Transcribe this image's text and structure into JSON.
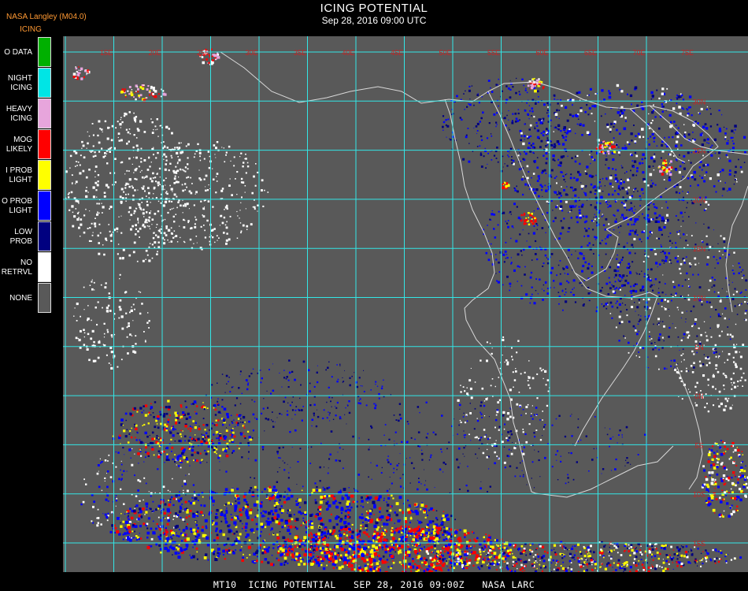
{
  "header": {
    "title": "ICING POTENTIAL",
    "subtitle": "Sep 28, 2016 09:00 UTC",
    "source": "NASA Langley (M04.0)",
    "product": "ICING"
  },
  "legend": [
    {
      "label": "O DATA",
      "color": "#00b000"
    },
    {
      "label": "NIGHT\nICING",
      "color": "#00e5e5"
    },
    {
      "label": "HEAVY\nICING",
      "color": "#e7a5dc"
    },
    {
      "label": "MOG\nLIKELY",
      "color": "#ff0000"
    },
    {
      "label": "I PROB\nLIGHT",
      "color": "#ffff00"
    },
    {
      "label": "O PROB\nLIGHT",
      "color": "#0000ff"
    },
    {
      "label": "LOW\nPROB",
      "color": "#000080"
    },
    {
      "label": "NO\nRETRVL",
      "color": "#ffffff"
    },
    {
      "label": "NONE",
      "color": "#595959"
    }
  ],
  "map": {
    "background_color": "#595959",
    "grid_color": "#33e6e6",
    "coastline_color": "#d9d9d9",
    "grid_label_color": "#cc2222",
    "lon_labels": [
      "15E",
      "20E",
      "25E",
      "30E",
      "35E",
      "40E",
      "45E",
      "50E",
      "55E",
      "60E",
      "65E",
      "70E",
      "75E"
    ],
    "lat_labels": [
      "35N",
      "30N",
      "25N",
      "20N",
      "15N",
      "10N",
      "5N",
      "0N",
      "5S",
      "10S",
      "15S",
      "20S"
    ]
  },
  "footer": "MT10  ICING POTENTIAL   SEP 28, 2016 09:00Z   NASA LARC"
}
